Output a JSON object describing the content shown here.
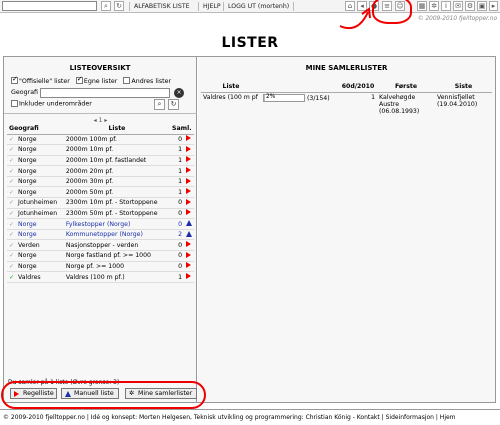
{
  "topbar": {
    "search_value": "",
    "nav": [
      "ALFABETISK LISTE",
      "HJELP",
      "LOGG UT (mortenh)"
    ],
    "icons": [
      "refresh-icon",
      "home-icon",
      "back-icon",
      "map-icon",
      "globe-icon",
      "list-icon",
      "user-icon",
      "gear-icon",
      "info-icon",
      "mail-icon",
      "settings-icon",
      "lock-icon",
      "flag-icon",
      "camera-icon"
    ],
    "copyright": "© 2009-2010 fjelltopper.no"
  },
  "page_title": "LISTER",
  "left": {
    "heading": "LISTEOVERSIKT",
    "filters": [
      {
        "label": "\"Offisielle\" lister",
        "checked": true
      },
      {
        "label": "Egne lister",
        "checked": true
      },
      {
        "label": "Andres lister",
        "checked": false
      }
    ],
    "geo_label": "Geografi",
    "geo_value": "",
    "include_sub_label": "Inkluder underområder",
    "pager": "1",
    "columns": [
      "Geografi",
      "Liste",
      "Saml."
    ],
    "rows": [
      {
        "geo": "Norge",
        "list": "2000m 100m pf.",
        "count": "0",
        "type": "flag",
        "done": false,
        "blue": false
      },
      {
        "geo": "Norge",
        "list": "2000m 10m pf.",
        "count": "1",
        "type": "flag",
        "done": false,
        "blue": false
      },
      {
        "geo": "Norge",
        "list": "2000m 10m pf. fastlandet",
        "count": "1",
        "type": "flag",
        "done": false,
        "blue": false
      },
      {
        "geo": "Norge",
        "list": "2000m 20m pf.",
        "count": "1",
        "type": "flag",
        "done": false,
        "blue": false
      },
      {
        "geo": "Norge",
        "list": "2000m 30m pf.",
        "count": "1",
        "type": "flag",
        "done": false,
        "blue": false
      },
      {
        "geo": "Norge",
        "list": "2000m 50m pf.",
        "count": "1",
        "type": "flag",
        "done": false,
        "blue": false
      },
      {
        "geo": "Jotunheimen",
        "list": "2300m 10m pf. - Stortoppene",
        "count": "0",
        "type": "flag",
        "done": false,
        "blue": false
      },
      {
        "geo": "Jotunheimen",
        "list": "2300m 50m pf. - Stortoppene",
        "count": "0",
        "type": "flag",
        "done": false,
        "blue": false
      },
      {
        "geo": "Norge",
        "list": "Fylkestopper (Norge)",
        "count": "0",
        "type": "tri",
        "done": false,
        "blue": true
      },
      {
        "geo": "Norge",
        "list": "Kommunetopper (Norge)",
        "count": "2",
        "type": "tri",
        "done": false,
        "blue": true
      },
      {
        "geo": "Verden",
        "list": "Nasjonstopper - verden",
        "count": "0",
        "type": "flag",
        "done": false,
        "blue": false
      },
      {
        "geo": "Norge",
        "list": "Norge fastland pf. >= 1000",
        "count": "0",
        "type": "flag",
        "done": false,
        "blue": false
      },
      {
        "geo": "Norge",
        "list": "Norge pf. >= 1000",
        "count": "0",
        "type": "flag",
        "done": false,
        "blue": false
      },
      {
        "geo": "Valdres",
        "list": "Valdres (100 m pf.)",
        "count": "1",
        "type": "flag",
        "done": true,
        "blue": false
      }
    ],
    "status": "Du samler på 1 liste (Øvre grense: 3)",
    "buttons": [
      "Regelliste",
      "Manuell liste",
      "Mine samlerlister"
    ]
  },
  "right": {
    "heading": "MINE SAMLERLISTER",
    "columns": [
      "Liste",
      "",
      "60d/2010",
      "Første",
      "Siste"
    ],
    "rows": [
      {
        "list": "Valdres (100 m pf",
        "progress_label": "2%",
        "progress": 0.02,
        "count": "(3/154)",
        "period": "1",
        "first": "Kalvehøgde Austre (06.08.1993)",
        "last": "Vennisfjellet (19.04.2010)"
      }
    ]
  },
  "footer": "© 2009-2010 fjelltopper.no | Idé og konsept: Morten Helgesen, Teknisk utvikling og programmering: Christian König - Kontakt | Sideinformasjon | Hjem"
}
